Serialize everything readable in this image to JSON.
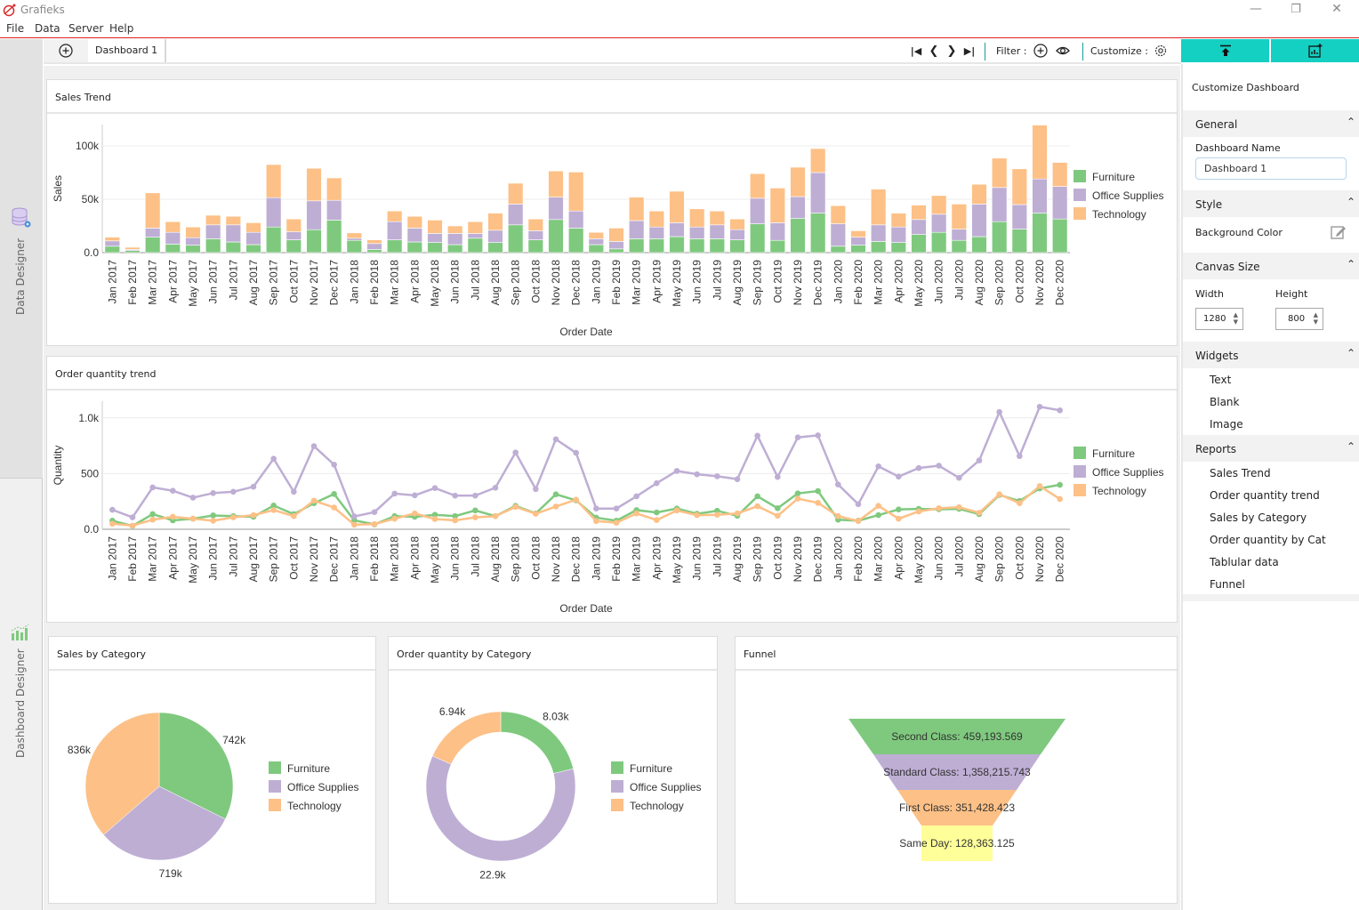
{
  "window": {
    "title": "Grafieks",
    "minimize_icon": "minimize-icon",
    "maximize_icon": "restore-icon",
    "close_icon": "close-icon"
  },
  "menu": [
    "File",
    "Data",
    "Server",
    "Help"
  ],
  "left_rail": {
    "data_designer_label": "Data Designer",
    "dashboard_designer_label": "Dashboard Designer"
  },
  "toolbar": {
    "tab_label": "Dashboard 1",
    "filter_label": "Filter :",
    "customize_label": "Customize :"
  },
  "colors": {
    "furniture": "#7fc97f",
    "office_supplies": "#beaed4",
    "technology": "#fdc086",
    "same_day": "#ffff99",
    "accent_teal": "#14d0c2",
    "menu_line": "#e02020"
  },
  "right_panel": {
    "title": "Customize Dashboard",
    "general": {
      "label": "General",
      "dashboard_name_label": "Dashboard Name",
      "dashboard_name_value": "Dashboard 1"
    },
    "style": {
      "label": "Style",
      "background_color_label": "Background Color"
    },
    "canvas_size": {
      "label": "Canvas Size",
      "width_label": "Width",
      "height_label": "Height",
      "width_value": "1280",
      "height_value": "800"
    },
    "widgets": {
      "label": "Widgets",
      "items": [
        "Text",
        "Blank",
        "Image"
      ]
    },
    "reports": {
      "label": "Reports",
      "items": [
        "Sales Trend",
        "Order quantity trend",
        "Sales by Category",
        "Order quantity by Cat",
        "Tablular data",
        "Funnel"
      ]
    }
  },
  "panels": {
    "sales_trend_title": "Sales Trend",
    "order_qty_title": "Order quantity trend",
    "sales_cat_title": "Sales by Category",
    "order_cat_title": "Order quantity by Category",
    "funnel_title": "Funnel"
  },
  "chart_data": [
    {
      "id": "sales_trend",
      "type": "bar",
      "stacked": true,
      "title": "Sales Trend",
      "xlabel": "Order Date",
      "ylabel": "Sales",
      "ylim": [
        0,
        120000
      ],
      "yticks": [
        0,
        50000,
        100000
      ],
      "ytick_labels": [
        "0.0",
        "50k",
        "100k"
      ],
      "legend": "right",
      "categories": [
        "Jan 2017",
        "Feb 2017",
        "Mar 2017",
        "Apr 2017",
        "May 2017",
        "Jun 2017",
        "Jul 2017",
        "Aug 2017",
        "Sep 2017",
        "Oct 2017",
        "Nov 2017",
        "Dec 2017",
        "Jan 2018",
        "Feb 2018",
        "Mar 2018",
        "Apr 2018",
        "May 2018",
        "Jun 2018",
        "Jul 2018",
        "Aug 2018",
        "Sep 2018",
        "Oct 2018",
        "Nov 2018",
        "Dec 2018",
        "Jan 2019",
        "Feb 2019",
        "Mar 2019",
        "Apr 2019",
        "May 2019",
        "Jun 2019",
        "Jul 2019",
        "Aug 2019",
        "Sep 2019",
        "Oct 2019",
        "Nov 2019",
        "Dec 2019",
        "Jan 2020",
        "Feb 2020",
        "Mar 2020",
        "Apr 2020",
        "May 2020",
        "Jun 2020",
        "Jul 2020",
        "Aug 2020",
        "Sep 2020",
        "Oct 2020",
        "Nov 2020",
        "Dec 2020"
      ],
      "series": [
        {
          "name": "Furniture",
          "values": [
            6000,
            2000,
            14500,
            8000,
            7000,
            13000,
            10000,
            7500,
            24000,
            12000,
            21500,
            30500,
            11500,
            3000,
            12000,
            10000,
            9500,
            7500,
            13500,
            9500,
            26000,
            12000,
            31000,
            23000,
            7500,
            3500,
            13000,
            13000,
            15000,
            13000,
            13000,
            12000,
            27000,
            11500,
            32000,
            37000,
            6000,
            7000,
            10500,
            9500,
            17000,
            19000,
            11500,
            15000,
            29000,
            22000,
            37000,
            31500
          ]
        },
        {
          "name": "Office Supplies",
          "values": [
            5000,
            1000,
            8500,
            11000,
            7000,
            13000,
            16000,
            11500,
            27500,
            7500,
            27000,
            18500,
            2000,
            5500,
            17000,
            13000,
            8500,
            10500,
            4500,
            11500,
            19500,
            8500,
            21000,
            16000,
            5500,
            7000,
            17000,
            11000,
            13000,
            11000,
            13000,
            9500,
            24000,
            16500,
            20500,
            38000,
            21000,
            7500,
            15500,
            14500,
            14000,
            17000,
            10500,
            30500,
            32000,
            23000,
            32000,
            30500
          ]
        },
        {
          "name": "Technology",
          "values": [
            3500,
            2000,
            33000,
            10000,
            10000,
            9000,
            8000,
            9000,
            31000,
            12000,
            30500,
            21000,
            5000,
            3500,
            10000,
            11000,
            12500,
            7000,
            11000,
            16000,
            19500,
            11000,
            24500,
            36500,
            6000,
            12500,
            22000,
            15000,
            29500,
            17000,
            13000,
            10000,
            23000,
            32500,
            27500,
            22500,
            17000,
            6000,
            33500,
            13000,
            13500,
            17500,
            23500,
            18500,
            27500,
            33500,
            50500,
            22500
          ]
        }
      ]
    },
    {
      "id": "order_qty_trend",
      "type": "line",
      "title": "Order quantity trend",
      "xlabel": "Order Date",
      "ylabel": "Quantity",
      "ylim": [
        0,
        1150
      ],
      "yticks": [
        0,
        500,
        1000
      ],
      "ytick_labels": [
        "0.0",
        "500",
        "1.0k"
      ],
      "legend": "right",
      "categories": [
        "Jan 2017",
        "Feb 2017",
        "Mar 2017",
        "Apr 2017",
        "May 2017",
        "Jun 2017",
        "Jul 2017",
        "Aug 2017",
        "Sep 2017",
        "Oct 2017",
        "Nov 2017",
        "Dec 2017",
        "Jan 2018",
        "Feb 2018",
        "Mar 2018",
        "Apr 2018",
        "May 2018",
        "Jun 2018",
        "Jul 2018",
        "Aug 2018",
        "Sep 2018",
        "Oct 2018",
        "Nov 2018",
        "Dec 2018",
        "Jan 2019",
        "Feb 2019",
        "Mar 2019",
        "Apr 2019",
        "May 2019",
        "Jun 2019",
        "Jul 2019",
        "Aug 2019",
        "Sep 2019",
        "Oct 2019",
        "Nov 2019",
        "Dec 2019",
        "Jan 2020",
        "Feb 2020",
        "Mar 2020",
        "Apr 2020",
        "May 2020",
        "Jun 2020",
        "Jul 2020",
        "Aug 2020",
        "Sep 2020",
        "Oct 2020",
        "Nov 2020",
        "Dec 2020"
      ],
      "series": [
        {
          "name": "Furniture",
          "values": [
            77,
            30,
            136,
            80,
            95,
            124,
            118,
            112,
            213,
            136,
            234,
            317,
            80,
            44,
            118,
            112,
            130,
            118,
            169,
            118,
            210,
            142,
            314,
            260,
            104,
            77,
            172,
            151,
            186,
            139,
            166,
            121,
            296,
            189,
            322,
            343,
            86,
            77,
            127,
            178,
            183,
            180,
            183,
            136,
            308,
            254,
            367,
            399
          ]
        },
        {
          "name": "Office Supplies",
          "values": [
            175,
            107,
            376,
            346,
            284,
            325,
            337,
            382,
            633,
            337,
            746,
            580,
            115,
            154,
            320,
            305,
            370,
            302,
            302,
            373,
            689,
            361,
            808,
            686,
            186,
            186,
            296,
            414,
            524,
            494,
            476,
            450,
            840,
            470,
            825,
            843,
            402,
            225,
            565,
            473,
            550,
            571,
            462,
            618,
            1053,
            657,
            1100,
            1068
          ]
        },
        {
          "name": "Technology",
          "values": [
            50,
            33,
            86,
            112,
            95,
            77,
            107,
            127,
            172,
            118,
            257,
            195,
            41,
            47,
            95,
            142,
            92,
            80,
            107,
            118,
            201,
            139,
            204,
            266,
            74,
            59,
            142,
            83,
            169,
            127,
            130,
            142,
            207,
            121,
            275,
            237,
            118,
            74,
            210,
            95,
            160,
            189,
            198,
            148,
            314,
            234,
            388,
            272
          ]
        }
      ]
    },
    {
      "id": "sales_by_category",
      "type": "pie",
      "title": "Sales by Category",
      "legend": "right",
      "categories": [
        "Furniture",
        "Office Supplies",
        "Technology"
      ],
      "values": [
        742000,
        719000,
        836000
      ],
      "labels": [
        "742k",
        "719k",
        "836k"
      ]
    },
    {
      "id": "order_qty_by_category",
      "type": "pie",
      "donut": true,
      "title": "Order quantity by Category",
      "legend": "right",
      "categories": [
        "Furniture",
        "Office Supplies",
        "Technology"
      ],
      "values": [
        8030,
        22900,
        6940
      ],
      "labels": [
        "8.03k",
        "22.9k",
        "6.94k"
      ]
    },
    {
      "id": "funnel",
      "type": "funnel",
      "title": "Funnel",
      "categories": [
        "Second Class",
        "Standard Class",
        "First Class",
        "Same Day"
      ],
      "values": [
        459193.569,
        1358215.743,
        351428.423,
        128363.125
      ],
      "labels": [
        "Second Class: 459,193.569",
        "Standard Class: 1,358,215.743",
        "First Class: 351,428.423",
        "Same Day: 128,363.125"
      ]
    }
  ]
}
